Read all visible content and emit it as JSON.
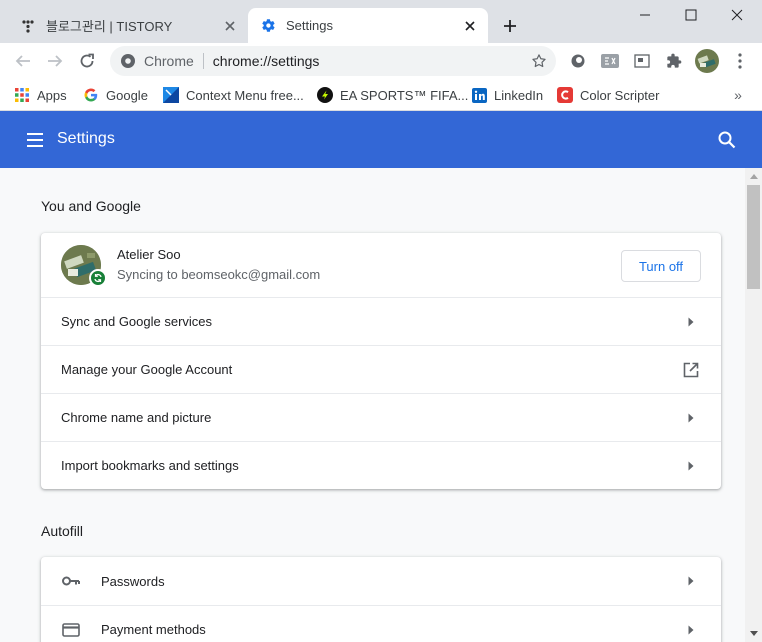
{
  "tabs": [
    {
      "title": "블로그관리 | TISTORY",
      "active": false,
      "favicon": "tistory-icon"
    },
    {
      "title": "Settings",
      "active": true,
      "favicon": "gear-icon"
    }
  ],
  "toolbar": {
    "omnibox_chip": "Chrome",
    "url": "chrome://settings"
  },
  "bookmarks": [
    {
      "label": "Apps",
      "icon": "apps-grid-icon"
    },
    {
      "label": "Google",
      "icon": "google-icon"
    },
    {
      "label": "Context Menu free...",
      "icon": "context-menu-icon"
    },
    {
      "label": "EA SPORTS™ FIFA...",
      "icon": "fifa-icon"
    },
    {
      "label": "LinkedIn",
      "icon": "linkedin-icon"
    },
    {
      "label": "Color Scripter",
      "icon": "color-scripter-icon"
    }
  ],
  "bookmarks_more": "»",
  "header": {
    "title": "Settings"
  },
  "you_and_google": {
    "title": "You and Google",
    "profile": {
      "name": "Atelier Soo",
      "email": "Syncing to beomseokc@gmail.com",
      "button": "Turn off"
    },
    "items": [
      {
        "label": "Sync and Google services",
        "type": "arrow"
      },
      {
        "label": "Manage your Google Account",
        "type": "external"
      },
      {
        "label": "Chrome name and picture",
        "type": "arrow"
      },
      {
        "label": "Import bookmarks and settings",
        "type": "arrow"
      }
    ]
  },
  "autofill": {
    "title": "Autofill",
    "items": [
      {
        "label": "Passwords",
        "icon": "key-icon"
      },
      {
        "label": "Payment methods",
        "icon": "credit-card-icon"
      }
    ]
  },
  "colors": {
    "header_blue": "#3367d6",
    "link_blue": "#1a73e8",
    "sync_green": "#188038"
  }
}
